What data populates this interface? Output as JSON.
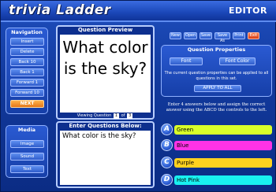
{
  "header": {
    "logo": "trivia Ladder",
    "mode": "EDITOR"
  },
  "navigation": {
    "title": "Navigation",
    "buttons": [
      "Insert",
      "Delete",
      "Back 10",
      "Back 1",
      "Forward 1",
      "Forward 10",
      "NEXT"
    ]
  },
  "media": {
    "title": "Media",
    "buttons": [
      "Image",
      "Sound",
      "Text"
    ]
  },
  "preview": {
    "title": "Question Preview",
    "question": "What color is the sky?",
    "viewing_label": "Viewing Question",
    "current": "1",
    "of_label": "of",
    "total": "3"
  },
  "enter_question": {
    "title": "Enter Questions Below:",
    "value": "What color is the sky?"
  },
  "file_buttons": [
    "New",
    "Open",
    "Save",
    "Save As",
    "Print",
    "Exit"
  ],
  "question_properties": {
    "title": "Question Properties",
    "font_label": "Font",
    "font_color_label": "Font Color",
    "description": "The current question properties can be applied to all questions in this set.",
    "apply_label": "APPLY TO ALL"
  },
  "instructions": "Enter 4 answers below and assign the correct answer using the ABCD the controls to the left.",
  "answers": [
    {
      "letter": "A",
      "text": "Green",
      "color": "#d9ff2a"
    },
    {
      "letter": "B",
      "text": "Blue",
      "color": "#ff33e6"
    },
    {
      "letter": "C",
      "text": "Purple",
      "color": "#ffd21f"
    },
    {
      "letter": "D",
      "text": "Hot Pink",
      "color": "#19f0f0"
    }
  ]
}
